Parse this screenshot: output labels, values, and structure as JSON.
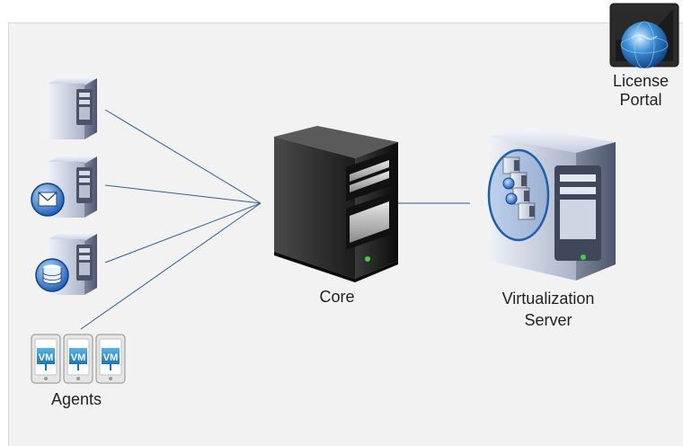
{
  "nodes": {
    "core": {
      "label": "Core"
    },
    "virtualization_server": {
      "line1": "Virtualization",
      "line2": "Server"
    },
    "license_portal": {
      "line1": "License",
      "line2": "Portal"
    },
    "agents": {
      "label": "Agents",
      "vm_badge": "VM"
    }
  },
  "colors": {
    "connector": "#2f5f9e",
    "server_dark": "#1a1a1a",
    "server_light": "#c9d3e6",
    "highlight_ellipse": "#2a6fc0"
  }
}
